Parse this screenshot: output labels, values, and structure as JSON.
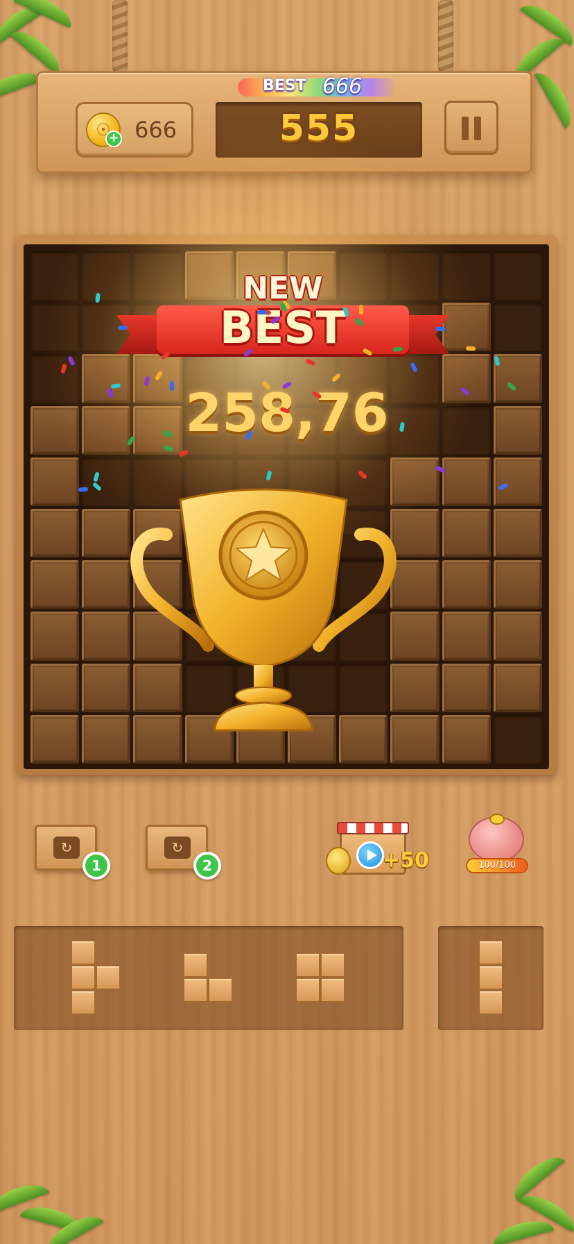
{
  "header": {
    "coins": "666",
    "best_label": "BEST",
    "best_value": "666",
    "score": "555"
  },
  "board": {
    "rows": [
      "EEEFFFEEEE",
      "EEEEEEEEFE",
      "EFFEEEEEFF",
      "FFFEEEEEEF",
      "FEEEEEEFFF",
      "FFFEEEEFFF",
      "FFFEEEEFFF",
      "FFFEEEEFFF",
      "FFFEEEEFFF",
      "FFFFFFFFFE"
    ]
  },
  "celebration": {
    "banner_top": "NEW",
    "banner_bottom": "BEST",
    "score": "258,76"
  },
  "powerups": [
    {
      "count": "1",
      "icon": "rotate-icon"
    },
    {
      "count": "2",
      "icon": "rotate-icon"
    }
  ],
  "shop": {
    "reward": "+50",
    "icon": "video-shop-icon"
  },
  "piggy_bank": {
    "label": "100/100",
    "progress": 1.0
  },
  "colors": {
    "accent_gold": "#ffc93a",
    "ribbon_red": "#d8261c",
    "badge_green": "#3fc54a"
  }
}
